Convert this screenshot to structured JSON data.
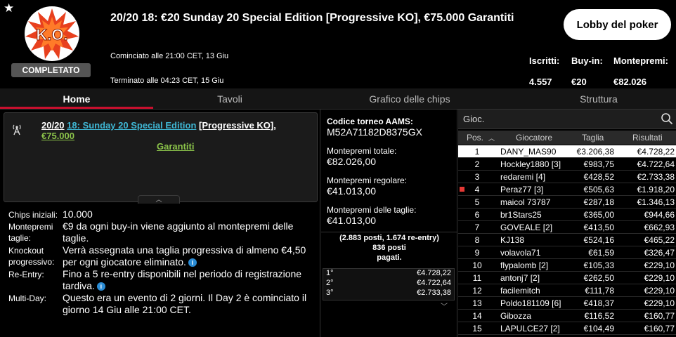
{
  "header": {
    "star": "★",
    "logo_text": "K.O.",
    "status": "COMPLETATO",
    "title": "20/20 18: €20 Sunday 20 Special Edition [Progressive KO], €75.000 Garantiti",
    "start_time": "Cominciato alle 21:00 CET, 13 Giu",
    "end_time": "Terminato alle 04:23 CET, 15 Giu",
    "lobby_button": "Lobby del poker",
    "stats": [
      {
        "label": "Iscritti:",
        "value": "4.557"
      },
      {
        "label": "Buy-in:",
        "value": "€20"
      },
      {
        "label": "Montepremi:",
        "value": "€82.026"
      }
    ],
    "colors": {
      "accent_red": "#c8102e",
      "logo_red": "#e8401e",
      "link_cyan": "#3fb6d3",
      "link_green": "#8bc34a"
    }
  },
  "tabs": [
    {
      "label": "Home",
      "active": true
    },
    {
      "label": "Tavoli",
      "active": false
    },
    {
      "label": "Grafico delle chips",
      "active": false
    },
    {
      "label": "Struttura",
      "active": false
    }
  ],
  "info": {
    "title_parts": [
      "20/20",
      "18: Sunday 20 Special Edition",
      "[Progressive KO],",
      "€75.000",
      "Garantiti"
    ],
    "collapse_glyph": "︿",
    "info_glyph": "i",
    "details": [
      {
        "label": "Chips iniziali:",
        "value": "10.000"
      },
      {
        "label": "Montepremi taglie:",
        "value": "€9 da ogni buy-in viene aggiunto al montepremi delle taglie."
      },
      {
        "label": "Knockout progressivo:",
        "value": "Verrà assegnata una taglia progressiva di almeno €4,50 per ogni giocatore eliminato."
      },
      {
        "label": "Re-Entry:",
        "value": "Fino a 5 re-entry disponibili nel periodo di registrazione tardiva."
      },
      {
        "label": "Multi-Day:",
        "value": "Questo era un evento di 2 giorni. Il Day 2 è cominciato il giorno 14 Giu alle 21:00 CET."
      }
    ]
  },
  "middle": {
    "aams_label": "Codice torneo AAMS:",
    "aams_code": "M52A71182D8375GX",
    "total_label": "Montepremi totale:",
    "total_value": "€82.026,00",
    "regular_label": "Montepremi regolare:",
    "regular_value": "€41.013,00",
    "bounty_label": "Montepremi delle taglie:",
    "bounty_value": "€41.013,00",
    "seats_line1": "(2.883 posti, 1.674 re-entry)",
    "seats_line2": "836 posti",
    "seats_line3": "pagati.",
    "prizes": [
      {
        "pos": "1°",
        "amount": "€4.728,22"
      },
      {
        "pos": "2°",
        "amount": "€4.722,64"
      },
      {
        "pos": "3°",
        "amount": "€2.733,38"
      }
    ],
    "chevron": "﹀"
  },
  "players": {
    "search_label": "Gioc.",
    "columns": {
      "pos": "Pos.",
      "sort_glyph": "︿",
      "name": "Giocatore",
      "chips": "Taglia",
      "prize": "Risultati"
    },
    "rows": [
      {
        "pos": "1",
        "name": "DANY_MAS90",
        "chips": "€3.206,38",
        "prize": "€4.728,22"
      },
      {
        "pos": "2",
        "name": "Hockley1880 [3]",
        "chips": "€983,75",
        "prize": "€4.722,64"
      },
      {
        "pos": "3",
        "name": "redaremi [4]",
        "chips": "€428,52",
        "prize": "€2.733,38"
      },
      {
        "pos": "4",
        "name": "Peraz77 [3]",
        "chips": "€505,63",
        "prize": "€1.918,20"
      },
      {
        "pos": "5",
        "name": "maicol 73787",
        "chips": "€287,18",
        "prize": "€1.346,13"
      },
      {
        "pos": "6",
        "name": "br1Stars25",
        "chips": "€365,00",
        "prize": "€944,66"
      },
      {
        "pos": "7",
        "name": "GOVEALE [2]",
        "chips": "€413,50",
        "prize": "€662,93"
      },
      {
        "pos": "8",
        "name": "KJ138",
        "chips": "€524,16",
        "prize": "€465,22"
      },
      {
        "pos": "9",
        "name": "volavola71",
        "chips": "€61,59",
        "prize": "€326,47"
      },
      {
        "pos": "10",
        "name": "flypalomb [2]",
        "chips": "€105,33",
        "prize": "€229,10"
      },
      {
        "pos": "11",
        "name": "antonj7 [2]",
        "chips": "€262,50",
        "prize": "€229,10"
      },
      {
        "pos": "12",
        "name": "facilemitch",
        "chips": "€111,78",
        "prize": "€229,10"
      },
      {
        "pos": "13",
        "name": "Poldo181109 [6]",
        "chips": "€418,37",
        "prize": "€229,10"
      },
      {
        "pos": "14",
        "name": "Gibozza",
        "chips": "€116,52",
        "prize": "€160,77"
      },
      {
        "pos": "15",
        "name": "LAPULCE27 [2]",
        "chips": "€104,49",
        "prize": "€160,77"
      }
    ]
  }
}
